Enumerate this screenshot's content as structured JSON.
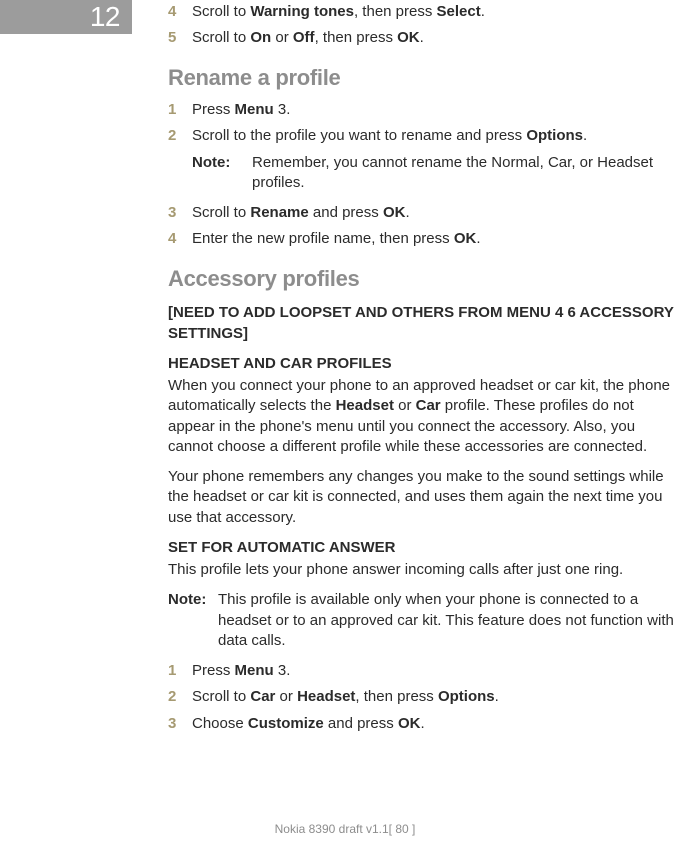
{
  "tab": {
    "number": "12"
  },
  "footer": {
    "text": "Nokia 8390 draft v1.1[ 80 ]"
  },
  "top_steps": [
    {
      "n": "4",
      "pre": "Scroll to ",
      "b1": "Warning tones",
      "mid": ", then press ",
      "b2": "Select",
      "post": "."
    },
    {
      "n": "5",
      "pre": "Scroll to ",
      "b1": "On",
      "mid": " or ",
      "b2": "Off",
      "mid2": ", then press ",
      "b3": "OK",
      "post": "."
    }
  ],
  "rename": {
    "heading": "Rename a profile",
    "step1": {
      "n": "1",
      "pre": "Press ",
      "b1": "Menu",
      "post": " 3."
    },
    "step2": {
      "n": "2",
      "pre": "Scroll to the profile you want to rename and press ",
      "b1": "Options",
      "post": "."
    },
    "note": {
      "label": "Note:",
      "text": "Remember, you cannot rename the Normal, Car, or Headset profiles."
    },
    "step3": {
      "n": "3",
      "pre": "Scroll to ",
      "b1": "Rename",
      "mid": " and press ",
      "b2": "OK",
      "post": "."
    },
    "step4": {
      "n": "4",
      "pre": "Enter the new profile name, then press ",
      "b1": "OK",
      "post": "."
    }
  },
  "accessory": {
    "heading": "Accessory profiles",
    "todo": "[NEED TO ADD LOOPSET AND OTHERS FROM MENU 4 6 ACCESSORY SETTINGS]",
    "sec1_title": "HEADSET AND CAR PROFILES",
    "sec1_p1a": "When you connect your phone to an approved headset or car kit, the phone automatically selects the ",
    "sec1_p1b1": "Headset",
    "sec1_p1mid": " or ",
    "sec1_p1b2": "Car",
    "sec1_p1c": " profile. These profiles do not appear in the phone's menu until you connect the accessory.  Also, you cannot choose a different profile while these accessories are connected.",
    "sec1_p2": "Your phone remembers any changes you make to the sound settings while the headset or car kit is connected, and uses them again the next time you use that accessory.",
    "sec2_title": "SET FOR AUTOMATIC ANSWER",
    "sec2_p1": "This profile lets your phone answer incoming calls after just one ring.",
    "note": {
      "label": "Note:",
      "text": "This profile is available only when your phone is connected to a headset or to an approved car kit.  This feature does not function with data calls."
    },
    "step1": {
      "n": "1",
      "pre": "Press ",
      "b1": "Menu",
      "post": " 3."
    },
    "step2": {
      "n": "2",
      "pre": "Scroll to ",
      "b1": "Car",
      "mid": " or ",
      "b2": "Headset",
      "mid2": ", then press ",
      "b3": "Options",
      "post": "."
    },
    "step3": {
      "n": "3",
      "pre": "Choose ",
      "b1": "Customize",
      "mid": " and press ",
      "b2": "OK",
      "post": "."
    }
  }
}
